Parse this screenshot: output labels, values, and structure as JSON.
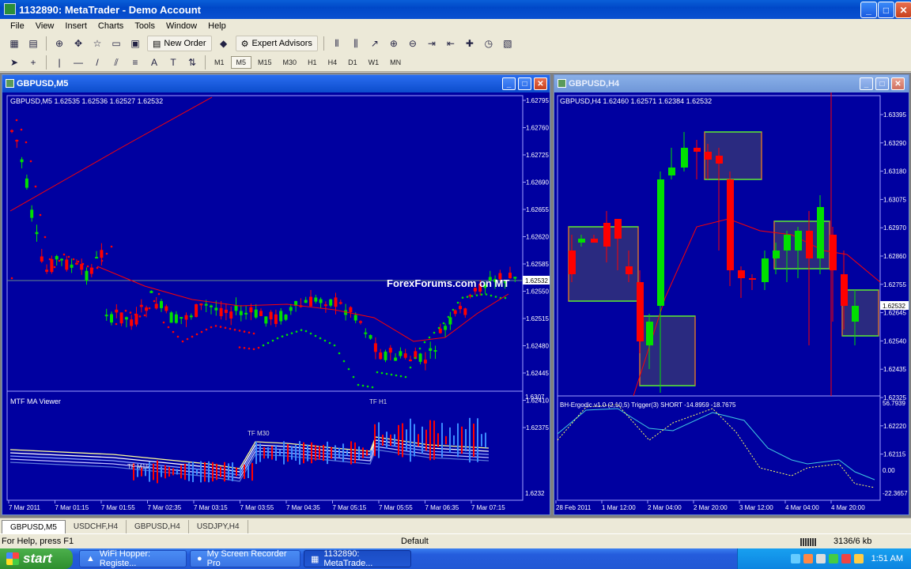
{
  "app": {
    "title": "1132890: MetaTrader - Demo Account",
    "minimize": "_",
    "maximize": "□",
    "close": "✕"
  },
  "menu": [
    "File",
    "View",
    "Insert",
    "Charts",
    "Tools",
    "Window",
    "Help"
  ],
  "toolbar": {
    "new_order": "New Order",
    "expert_advisors": "Expert Advisors",
    "timeframes": [
      "M1",
      "M5",
      "M15",
      "M30",
      "H1",
      "H4",
      "D1",
      "W1",
      "MN"
    ],
    "active_timeframe": "M5"
  },
  "left_window": {
    "title": "GBPUSD,M5",
    "info": "GBPUSD,M5  1.62535 1.62536 1.62527 1.62532",
    "watermark": "ForexForums.com on MT",
    "price_labels": [
      "1.62795",
      "1.62760",
      "1.62725",
      "1.62690",
      "1.62655",
      "1.62620",
      "1.62585",
      "1.62550",
      "1.62515",
      "1.62480",
      "1.62445",
      "1.62410",
      "1.62375"
    ],
    "current_price": "1.62532",
    "indicator_title": "MTF MA Viewer",
    "indicator_labels": {
      "h1": "TF H1",
      "m30": "TF M30",
      "m15": "TF M15"
    },
    "indicator_scale": [
      "1.6307",
      "1.6232"
    ],
    "time_labels": [
      "7 Mar 2011",
      "7 Mar 01:15",
      "7 Mar 01:55",
      "7 Mar 02:35",
      "7 Mar 03:15",
      "7 Mar 03:55",
      "7 Mar 04:35",
      "7 Mar 05:15",
      "7 Mar 05:55",
      "7 Mar 06:35",
      "7 Mar 07:15"
    ]
  },
  "right_window": {
    "title": "GBPUSD,H4",
    "info": "GBPUSD,H4  1.62460 1.62571 1.62384 1.62532",
    "price_labels": [
      "1.63395",
      "1.63290",
      "1.63180",
      "1.63075",
      "1.62970",
      "1.62860",
      "1.62755",
      "1.62645",
      "1.62540",
      "1.62435",
      "1.62325",
      "1.62220",
      "1.62115"
    ],
    "current_price": "1.62532",
    "indicator_title": "BH-Ergodic v1.0 (2,10,5) Trigger(3) SHORT -14.8959 -18.7675",
    "indicator_scale": [
      "56.7939",
      "0.00",
      "-22.3657"
    ],
    "time_labels": [
      "28 Feb 2011",
      "1 Mar 12:00",
      "2 Mar 04:00",
      "2 Mar 20:00",
      "3 Mar 12:00",
      "4 Mar 04:00",
      "4 Mar 20:00"
    ]
  },
  "tabs": [
    "GBPUSD,M5",
    "USDCHF,H4",
    "GBPUSD,H4",
    "USDJPY,H4"
  ],
  "active_tab": "GBPUSD,M5",
  "status": {
    "help": "For Help, press F1",
    "profile": "Default",
    "traffic": "3136/6 kb"
  },
  "taskbar": {
    "start": "start",
    "tasks": [
      "WiFi Hopper: Registe...",
      "My Screen Recorder Pro",
      "1132890: MetaTrade..."
    ],
    "clock": "1:51 AM"
  },
  "colors": {
    "chart_bg": "#0000a0",
    "bull": "#00e000",
    "bear": "#ff0000",
    "grid": "#3a3ad0"
  }
}
